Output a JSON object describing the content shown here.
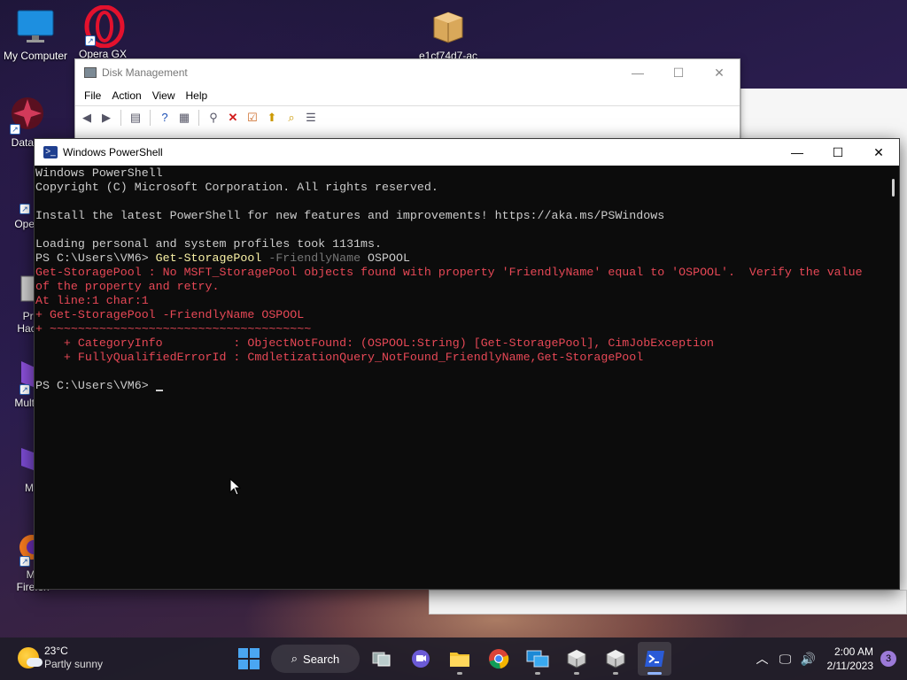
{
  "desktop": {
    "icons": [
      {
        "label": "My Computer"
      },
      {
        "label": "Opera GX"
      },
      {
        "label": "e1cf74d7-ac"
      },
      {
        "label": "DataW"
      },
      {
        "label": "Opera"
      },
      {
        "label": "Pro"
      },
      {
        "label": "Hack"
      },
      {
        "label": "Multi-"
      },
      {
        "label": "ME"
      },
      {
        "label": "Mo"
      },
      {
        "label": "Firefox"
      }
    ]
  },
  "disk_management": {
    "title": "Disk Management",
    "menu": [
      "File",
      "Action",
      "View",
      "Help"
    ],
    "controls": {
      "minimize": "—",
      "maximize": "☐",
      "close": "✕"
    }
  },
  "powershell": {
    "title": "Windows PowerShell",
    "controls": {
      "minimize": "—",
      "maximize": "☐",
      "close": "✕"
    },
    "lines": [
      {
        "segments": [
          {
            "text": "Windows PowerShell",
            "color": "white"
          }
        ]
      },
      {
        "segments": [
          {
            "text": "Copyright (C) Microsoft Corporation. All rights reserved.",
            "color": "white"
          }
        ]
      },
      {
        "segments": [
          {
            "text": "",
            "color": "white"
          }
        ]
      },
      {
        "segments": [
          {
            "text": "Install the latest PowerShell for new features and improvements! https://aka.ms/PSWindows",
            "color": "white"
          }
        ]
      },
      {
        "segments": [
          {
            "text": "",
            "color": "white"
          }
        ]
      },
      {
        "segments": [
          {
            "text": "Loading personal and system profiles took 1131ms.",
            "color": "white"
          }
        ]
      },
      {
        "segments": [
          {
            "text": "PS C:\\Users\\VM6> ",
            "color": "white"
          },
          {
            "text": "Get-StoragePool",
            "color": "yellow"
          },
          {
            "text": " -FriendlyName",
            "color": "gray"
          },
          {
            "text": " OSPOOL",
            "color": "white"
          }
        ]
      },
      {
        "segments": [
          {
            "text": "Get-StoragePool : No MSFT_StoragePool objects found with property 'FriendlyName' equal to 'OSPOOL'.  Verify the value",
            "color": "red"
          }
        ]
      },
      {
        "segments": [
          {
            "text": "of the property and retry.",
            "color": "red"
          }
        ]
      },
      {
        "segments": [
          {
            "text": "At line:1 char:1",
            "color": "red"
          }
        ]
      },
      {
        "segments": [
          {
            "text": "+ Get-StoragePool -FriendlyName OSPOOL",
            "color": "red"
          }
        ]
      },
      {
        "segments": [
          {
            "text": "+ ~~~~~~~~~~~~~~~~~~~~~~~~~~~~~~~~~~~~~",
            "color": "red"
          }
        ]
      },
      {
        "segments": [
          {
            "text": "    + CategoryInfo          : ObjectNotFound: (OSPOOL:String) [Get-StoragePool], CimJobException",
            "color": "red"
          }
        ]
      },
      {
        "segments": [
          {
            "text": "    + FullyQualifiedErrorId : CmdletizationQuery_NotFound_FriendlyName,Get-StoragePool",
            "color": "red"
          }
        ]
      },
      {
        "segments": [
          {
            "text": "",
            "color": "white"
          }
        ]
      },
      {
        "segments": [
          {
            "text": "PS C:\\Users\\VM6> ",
            "color": "white"
          }
        ],
        "cursor": true
      }
    ]
  },
  "taskbar": {
    "weather": {
      "temp": "23°C",
      "condition": "Partly sunny"
    },
    "search_label": "Search",
    "clock": {
      "time": "2:00 AM",
      "date": "2/11/2023"
    },
    "notification_count": "3"
  }
}
